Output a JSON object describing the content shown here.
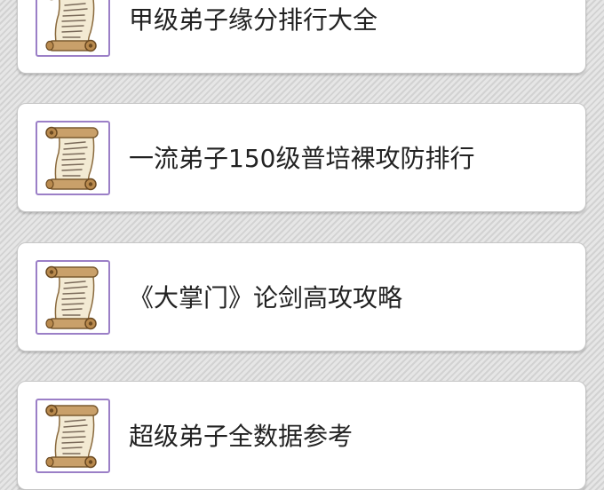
{
  "colors": {
    "thumb_border": "#9b7fc7",
    "card_bg": "#ffffff",
    "text": "#222222",
    "background": "#dcdcdc"
  },
  "list": {
    "items": [
      {
        "title": "甲级弟子缘分排行大全",
        "icon": "scroll-icon"
      },
      {
        "title": "一流弟子150级普培裸攻防排行",
        "icon": "scroll-icon"
      },
      {
        "title": "《大掌门》论剑高攻攻略",
        "icon": "scroll-icon"
      },
      {
        "title": "超级弟子全数据参考",
        "icon": "scroll-icon"
      }
    ]
  }
}
